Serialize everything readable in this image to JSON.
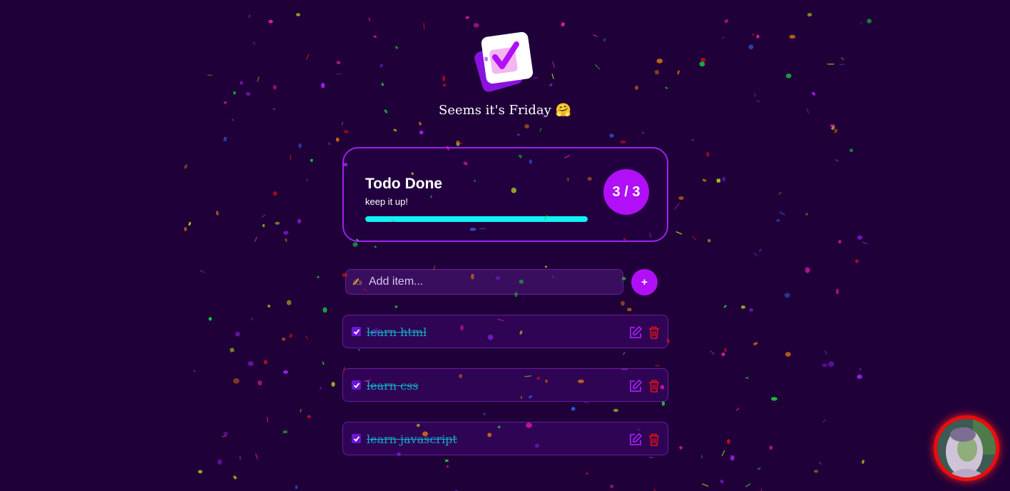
{
  "greeting": {
    "text": "Seems it's Friday",
    "emoji": "🤗"
  },
  "summary": {
    "title": "Todo Done",
    "subtitle": "keep it up!",
    "count": "3 / 3",
    "progress": 1.0
  },
  "add": {
    "placeholder": "Add item...",
    "icon": "✍",
    "button_label": "+"
  },
  "todos": [
    {
      "text": "learn html",
      "done": true
    },
    {
      "text": "learn css",
      "done": true
    },
    {
      "text": "learn javascript",
      "done": true
    }
  ],
  "icons": {
    "logo": "checkbox-logo-icon",
    "edit": "edit-icon",
    "delete": "trash-icon",
    "avatar": "user-avatar"
  },
  "colors": {
    "background": "#1f0039",
    "accent": "#b10ff7",
    "progress": "#12f1f5",
    "done_text": "#14a9c7",
    "danger": "#d0111b"
  }
}
